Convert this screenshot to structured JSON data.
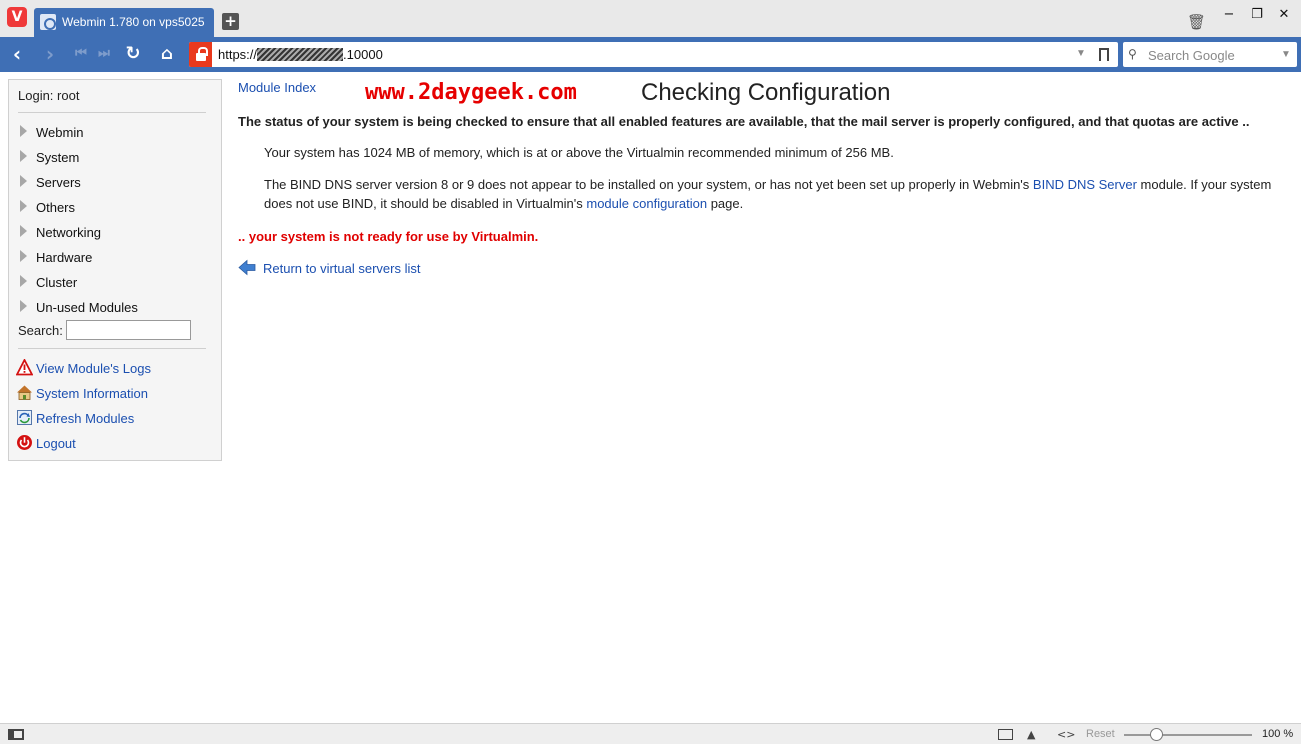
{
  "browser": {
    "logo": "V",
    "tab_title": "Webmin 1.780 on vps5025",
    "new_tab": "+",
    "window_controls": {
      "minimize": "−",
      "restore": "❐",
      "close": "✕"
    },
    "url": {
      "prefix": "https://",
      "suffix": ".10000"
    },
    "search_placeholder": "Search Google"
  },
  "sidebar": {
    "login": "Login: root",
    "categories": [
      {
        "label": "Webmin"
      },
      {
        "label": "System"
      },
      {
        "label": "Servers"
      },
      {
        "label": "Others"
      },
      {
        "label": "Networking"
      },
      {
        "label": "Hardware"
      },
      {
        "label": "Cluster"
      },
      {
        "label": "Un-used Modules"
      }
    ],
    "search_label": "Search:",
    "search_value": "",
    "links": [
      {
        "label": "View Module's Logs",
        "icon": "warning-icon"
      },
      {
        "label": "System Information",
        "icon": "house-icon"
      },
      {
        "label": "Refresh Modules",
        "icon": "refresh-icon"
      },
      {
        "label": "Logout",
        "icon": "power-icon"
      }
    ]
  },
  "main": {
    "module_index": "Module Index",
    "watermark": "www.2daygeek.com",
    "title": "Checking Configuration",
    "status_heading": "The status of your system is being checked to ensure that all enabled features are available, that the mail server is properly configured, and that quotas are active ..",
    "memory_message": "Your system has 1024 MB of memory, which is at or above the Virtualmin recommended minimum of 256 MB.",
    "bind_message": {
      "part1": "The BIND DNS server version 8 or 9 does not appear to be installed on your system, or has not yet been set up properly in Webmin's ",
      "link1": "BIND DNS Server",
      "part2": " module. If your system does not use BIND, it should be disabled in Virtualmin's ",
      "link2": "module configuration",
      "part3": " page."
    },
    "not_ready": ".. your system is not ready for use by Virtualmin.",
    "return_link": "Return to virtual servers list"
  },
  "statusbar": {
    "reset": "Reset",
    "zoom": "100 %",
    "zoom_fraction": 0.25
  },
  "colors": {
    "chrome_blue": "#3f6fb5",
    "link_blue": "#1b4fb0",
    "error_red": "#e00000",
    "watermark_red": "#e60000"
  }
}
